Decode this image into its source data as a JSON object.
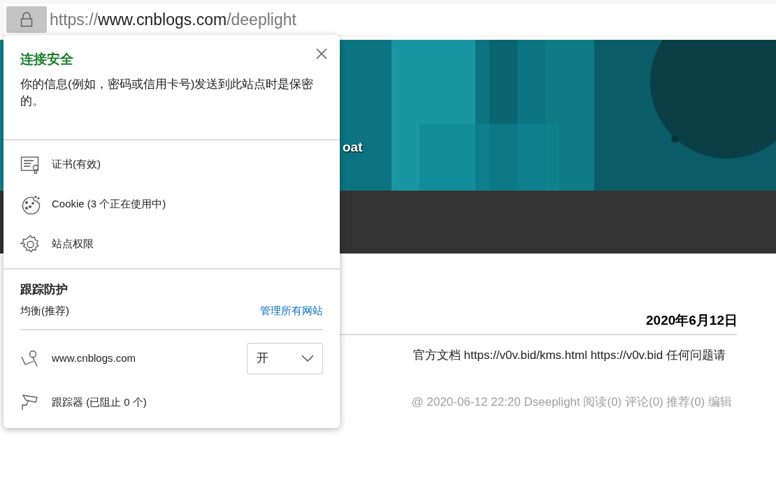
{
  "address_bar": {
    "scheme": "https://",
    "host": "www.cnblogs.com",
    "path": "/deeplight"
  },
  "page": {
    "banner_text": "oat",
    "date": "2020年6月12日",
    "body": "官方文档 https://v0v.bid/kms.html https://v0v.bid 任何问题请",
    "footer": "@ 2020-06-12 22:20 Dseeplight 阅读(0) 评论(0) 推荐(0) 编辑"
  },
  "popup": {
    "title": "连接安全",
    "description": "你的信息(例如，密码或信用卡号)发送到此站点时是保密的。",
    "items": [
      {
        "kind": "certificate",
        "label": "证书(有效)"
      },
      {
        "kind": "cookie",
        "label": "Cookie (3 个正在使用中)"
      },
      {
        "kind": "settings",
        "label": "站点权限"
      }
    ],
    "tracking": {
      "title": "跟踪防护",
      "mode": "均衡(推荐)",
      "manage_link": "管理所有网站",
      "site": "www.cnblogs.com",
      "toggle_value": "开",
      "trackers": "跟踪器 (已阻止 0 个)"
    }
  }
}
